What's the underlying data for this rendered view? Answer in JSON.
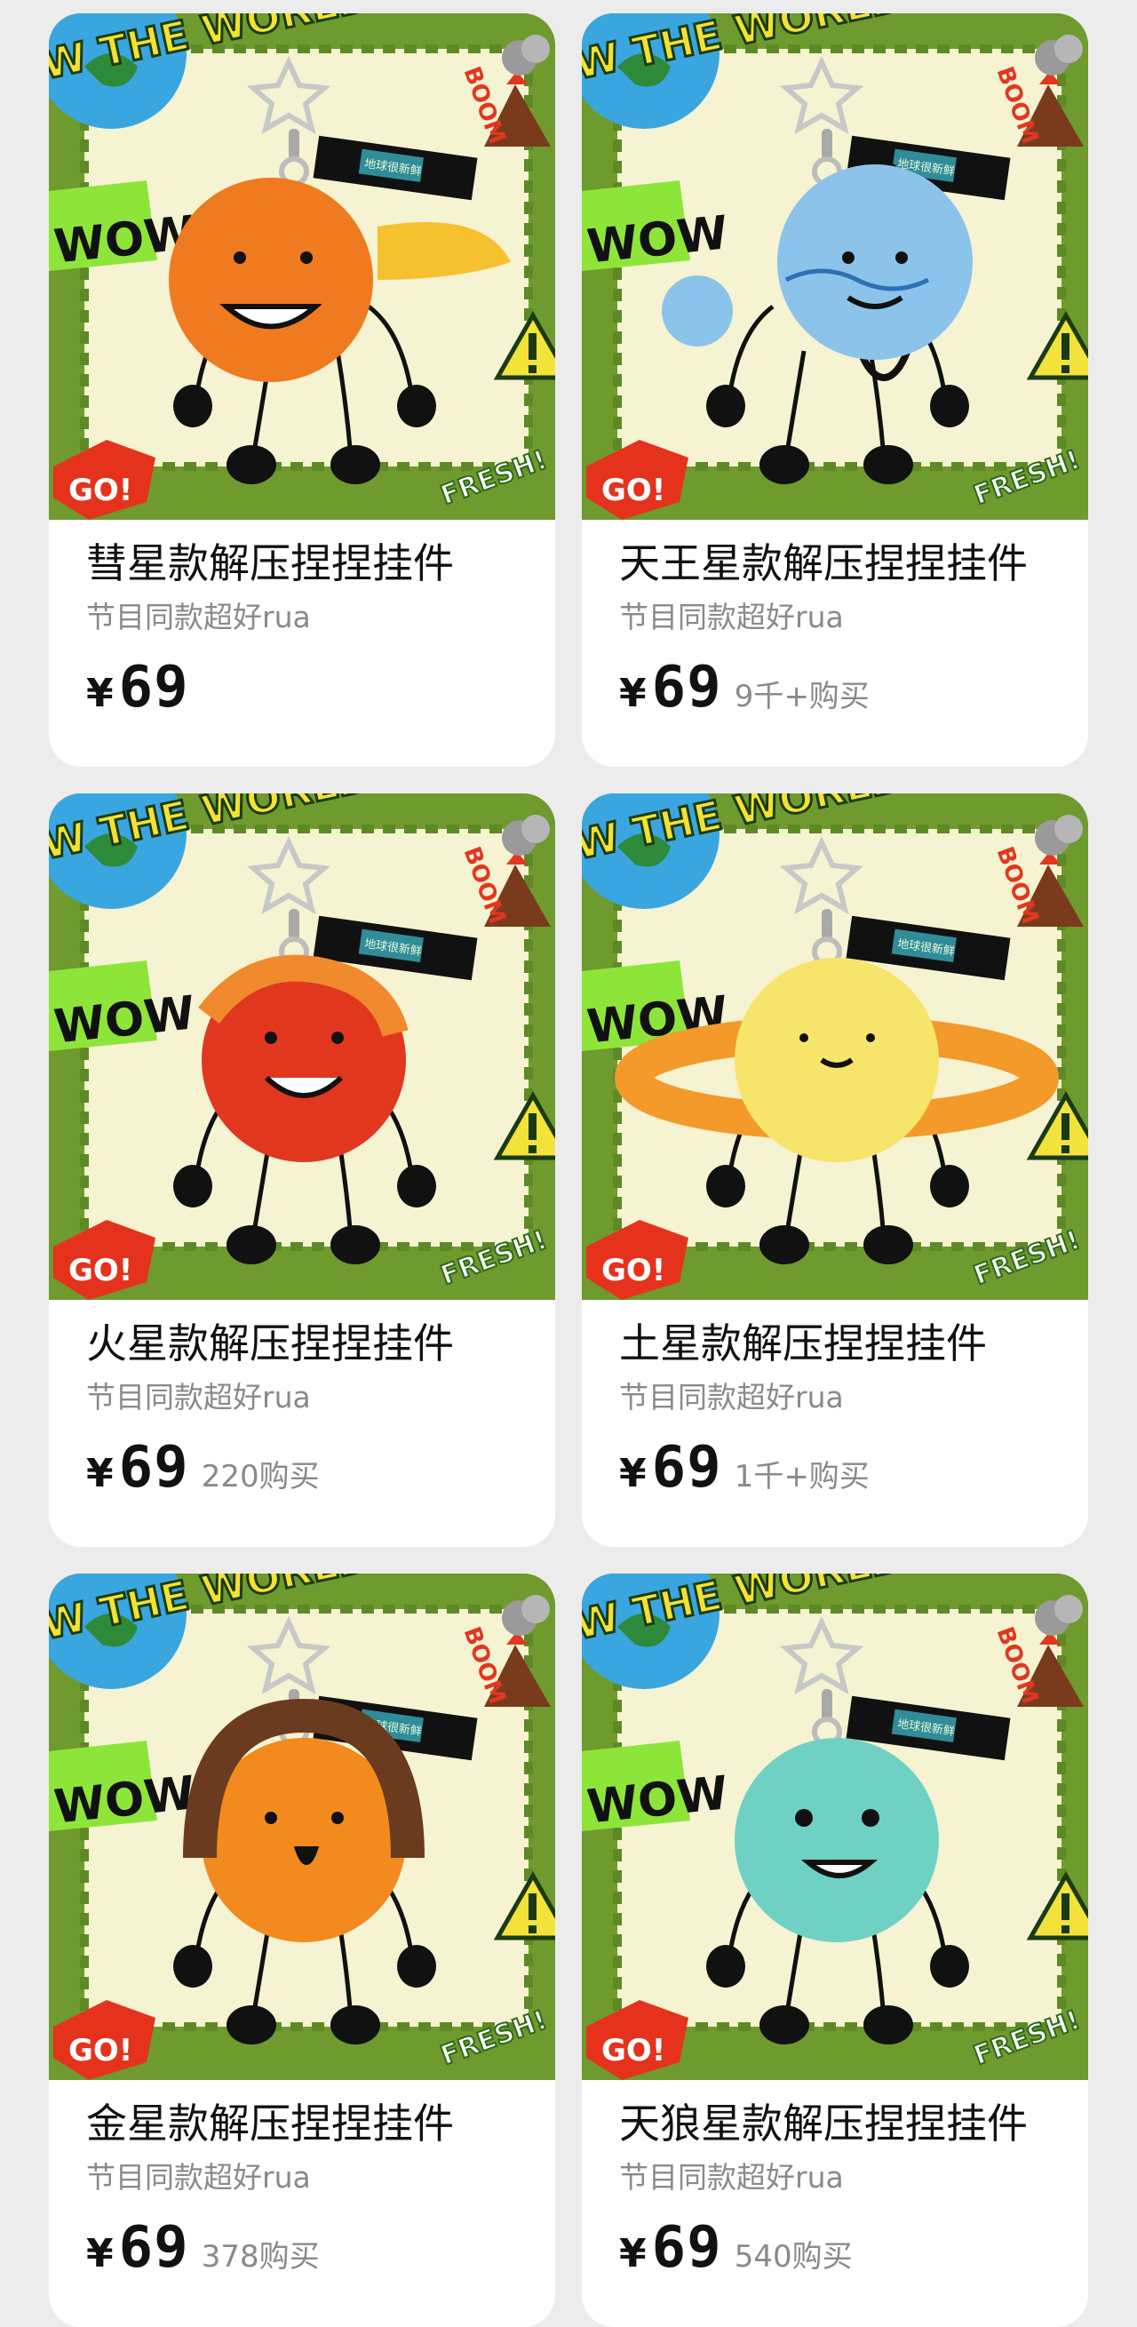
{
  "products": [
    {
      "title": "彗星款解压捏捏挂件",
      "subtitle": "节目同款超好rua",
      "currency": "¥",
      "price": "69",
      "sold": "",
      "planet": "comet",
      "colors": {
        "body": "#f07a1f",
        "accent": "#f6c12e"
      }
    },
    {
      "title": "天王星款解压捏捏挂件",
      "subtitle": "节目同款超好rua",
      "currency": "¥",
      "price": "69",
      "sold": "9千+购买",
      "planet": "uranus",
      "colors": {
        "body": "#8cc3ea",
        "accent": "#2e6fb5"
      }
    },
    {
      "title": "火星款解压捏捏挂件",
      "subtitle": "节目同款超好rua",
      "currency": "¥",
      "price": "69",
      "sold": "220购买",
      "planet": "mars",
      "colors": {
        "body": "#e2371f",
        "accent": "#f08a2c"
      }
    },
    {
      "title": "土星款解压捏捏挂件",
      "subtitle": "节目同款超好rua",
      "currency": "¥",
      "price": "69",
      "sold": "1千+购买",
      "planet": "saturn",
      "colors": {
        "body": "#f7e46a",
        "accent": "#f39a2a"
      }
    },
    {
      "title": "金星款解压捏捏挂件",
      "subtitle": "节目同款超好rua",
      "currency": "¥",
      "price": "69",
      "sold": "378购买",
      "planet": "venus",
      "colors": {
        "body": "#f28a1d",
        "accent": "#6b3b1f"
      }
    },
    {
      "title": "天狼星款解压捏捏挂件",
      "subtitle": "节目同款超好rua",
      "currency": "¥",
      "price": "69",
      "sold": "540购买",
      "planet": "sirius",
      "colors": {
        "body": "#6fd1c4",
        "accent": "#3aa596"
      }
    }
  ],
  "badges": {
    "wow": "WOW",
    "go": "GO!",
    "fresh": "FRESH!",
    "boom": "BOOM",
    "world": "W THE WORLD",
    "tag": "地球很新鲜"
  }
}
